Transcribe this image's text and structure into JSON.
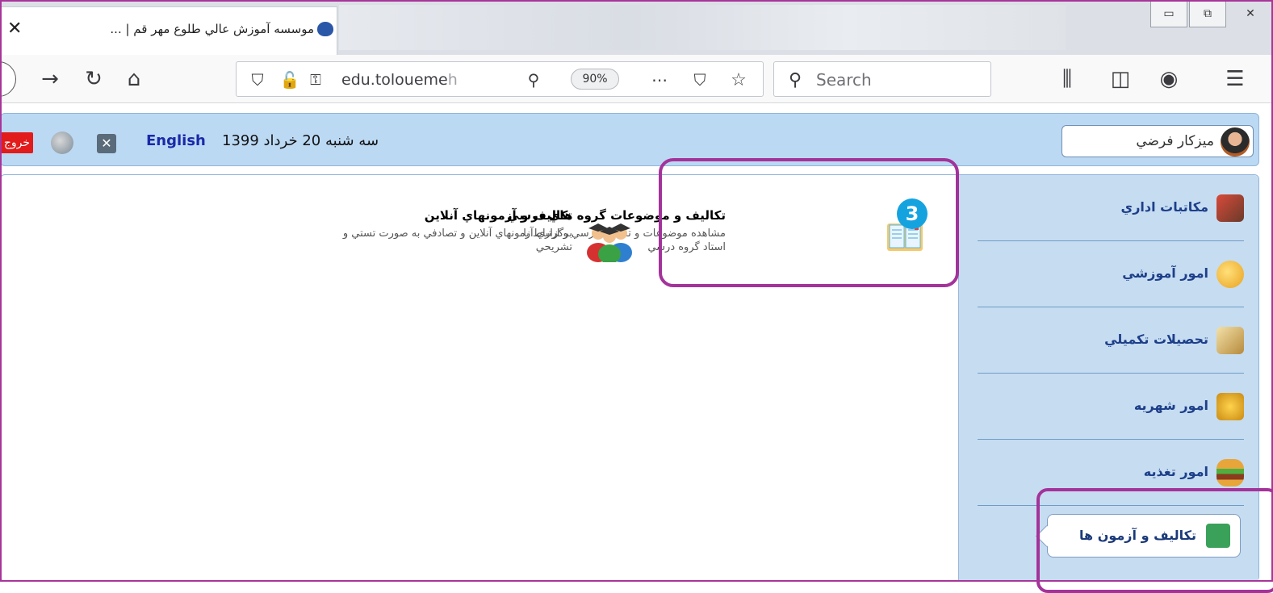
{
  "browser": {
    "tab_title": "موسسه آموزش عالي طلوع مهر قم | ...",
    "url_host": "edu.toloueme",
    "url_faded": "h",
    "zoom": "90%",
    "search_placeholder": "Search"
  },
  "header": {
    "exit_label": "خروج",
    "english_link": "English",
    "date_text": "سه شنبه 20 خرداد 1399",
    "user_name": "ميزكار فرضي"
  },
  "sidebar": {
    "items": [
      {
        "label": "مكاتبات اداري",
        "icon": "office-letters-icon"
      },
      {
        "label": "امور آموزشي",
        "icon": "education-icon"
      },
      {
        "label": "تحصيلات تكميلي",
        "icon": "graduate-icon"
      },
      {
        "label": "امور شهريه",
        "icon": "coins-icon"
      },
      {
        "label": "امور تغذيه",
        "icon": "burger-icon"
      }
    ],
    "active_item": {
      "label": "تكاليف و آزمون ها",
      "icon": "exam-icon"
    }
  },
  "cards": [
    {
      "title": "تكاليف و موضوعات گروه هاي درسي",
      "description": "مشاهده موضوعات و تكاليف درسي و ارتباط با استاد گروه درسي",
      "icon": "open-book-icon"
    },
    {
      "title": "تكاليف و آزمونهاي آنلاين",
      "description": "برگزاري آزمونهاي آنلاين و تصادفي به صورت تستي و تشريحي",
      "icon": "graduates-group-icon"
    }
  ],
  "annotation": {
    "step": "3"
  },
  "colors": {
    "annotation_border": "#a3339a",
    "badge": "#15a3e0",
    "sidebar_bg": "#c6dcf1",
    "header_bg": "#bcd9f4",
    "exit_red": "#e21b1b"
  }
}
